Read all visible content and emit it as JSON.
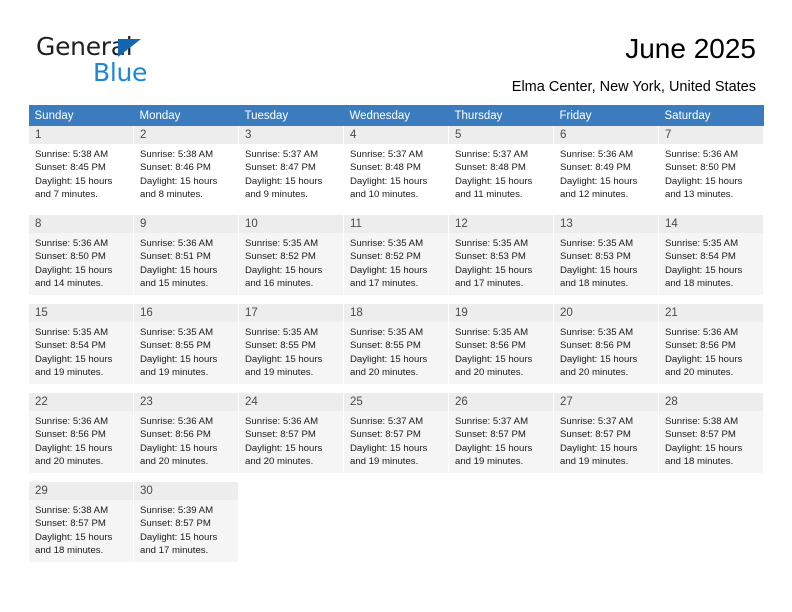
{
  "brand": {
    "name_part1": "General",
    "name_part2": "Blue",
    "accent_color": "#1d86d8",
    "triangle_color": "#1566b0"
  },
  "header": {
    "title": "June 2025",
    "subtitle": "Elma Center, New York, United States"
  },
  "calendar": {
    "header_bg": "#3b7cbf",
    "weekday_headers": [
      "Sunday",
      "Monday",
      "Tuesday",
      "Wednesday",
      "Thursday",
      "Friday",
      "Saturday"
    ],
    "weeks": [
      {
        "shaded": false,
        "days": [
          {
            "day": "1",
            "sunrise": "Sunrise: 5:38 AM",
            "sunset": "Sunset: 8:45 PM",
            "daylight_line1": "Daylight: 15 hours",
            "daylight_line2": "and 7 minutes."
          },
          {
            "day": "2",
            "sunrise": "Sunrise: 5:38 AM",
            "sunset": "Sunset: 8:46 PM",
            "daylight_line1": "Daylight: 15 hours",
            "daylight_line2": "and 8 minutes."
          },
          {
            "day": "3",
            "sunrise": "Sunrise: 5:37 AM",
            "sunset": "Sunset: 8:47 PM",
            "daylight_line1": "Daylight: 15 hours",
            "daylight_line2": "and 9 minutes."
          },
          {
            "day": "4",
            "sunrise": "Sunrise: 5:37 AM",
            "sunset": "Sunset: 8:48 PM",
            "daylight_line1": "Daylight: 15 hours",
            "daylight_line2": "and 10 minutes."
          },
          {
            "day": "5",
            "sunrise": "Sunrise: 5:37 AM",
            "sunset": "Sunset: 8:48 PM",
            "daylight_line1": "Daylight: 15 hours",
            "daylight_line2": "and 11 minutes."
          },
          {
            "day": "6",
            "sunrise": "Sunrise: 5:36 AM",
            "sunset": "Sunset: 8:49 PM",
            "daylight_line1": "Daylight: 15 hours",
            "daylight_line2": "and 12 minutes."
          },
          {
            "day": "7",
            "sunrise": "Sunrise: 5:36 AM",
            "sunset": "Sunset: 8:50 PM",
            "daylight_line1": "Daylight: 15 hours",
            "daylight_line2": "and 13 minutes."
          }
        ]
      },
      {
        "shaded": true,
        "days": [
          {
            "day": "8",
            "sunrise": "Sunrise: 5:36 AM",
            "sunset": "Sunset: 8:50 PM",
            "daylight_line1": "Daylight: 15 hours",
            "daylight_line2": "and 14 minutes."
          },
          {
            "day": "9",
            "sunrise": "Sunrise: 5:36 AM",
            "sunset": "Sunset: 8:51 PM",
            "daylight_line1": "Daylight: 15 hours",
            "daylight_line2": "and 15 minutes."
          },
          {
            "day": "10",
            "sunrise": "Sunrise: 5:35 AM",
            "sunset": "Sunset: 8:52 PM",
            "daylight_line1": "Daylight: 15 hours",
            "daylight_line2": "and 16 minutes."
          },
          {
            "day": "11",
            "sunrise": "Sunrise: 5:35 AM",
            "sunset": "Sunset: 8:52 PM",
            "daylight_line1": "Daylight: 15 hours",
            "daylight_line2": "and 17 minutes."
          },
          {
            "day": "12",
            "sunrise": "Sunrise: 5:35 AM",
            "sunset": "Sunset: 8:53 PM",
            "daylight_line1": "Daylight: 15 hours",
            "daylight_line2": "and 17 minutes."
          },
          {
            "day": "13",
            "sunrise": "Sunrise: 5:35 AM",
            "sunset": "Sunset: 8:53 PM",
            "daylight_line1": "Daylight: 15 hours",
            "daylight_line2": "and 18 minutes."
          },
          {
            "day": "14",
            "sunrise": "Sunrise: 5:35 AM",
            "sunset": "Sunset: 8:54 PM",
            "daylight_line1": "Daylight: 15 hours",
            "daylight_line2": "and 18 minutes."
          }
        ]
      },
      {
        "shaded": true,
        "days": [
          {
            "day": "15",
            "sunrise": "Sunrise: 5:35 AM",
            "sunset": "Sunset: 8:54 PM",
            "daylight_line1": "Daylight: 15 hours",
            "daylight_line2": "and 19 minutes."
          },
          {
            "day": "16",
            "sunrise": "Sunrise: 5:35 AM",
            "sunset": "Sunset: 8:55 PM",
            "daylight_line1": "Daylight: 15 hours",
            "daylight_line2": "and 19 minutes."
          },
          {
            "day": "17",
            "sunrise": "Sunrise: 5:35 AM",
            "sunset": "Sunset: 8:55 PM",
            "daylight_line1": "Daylight: 15 hours",
            "daylight_line2": "and 19 minutes."
          },
          {
            "day": "18",
            "sunrise": "Sunrise: 5:35 AM",
            "sunset": "Sunset: 8:55 PM",
            "daylight_line1": "Daylight: 15 hours",
            "daylight_line2": "and 20 minutes."
          },
          {
            "day": "19",
            "sunrise": "Sunrise: 5:35 AM",
            "sunset": "Sunset: 8:56 PM",
            "daylight_line1": "Daylight: 15 hours",
            "daylight_line2": "and 20 minutes."
          },
          {
            "day": "20",
            "sunrise": "Sunrise: 5:35 AM",
            "sunset": "Sunset: 8:56 PM",
            "daylight_line1": "Daylight: 15 hours",
            "daylight_line2": "and 20 minutes."
          },
          {
            "day": "21",
            "sunrise": "Sunrise: 5:36 AM",
            "sunset": "Sunset: 8:56 PM",
            "daylight_line1": "Daylight: 15 hours",
            "daylight_line2": "and 20 minutes."
          }
        ]
      },
      {
        "shaded": true,
        "days": [
          {
            "day": "22",
            "sunrise": "Sunrise: 5:36 AM",
            "sunset": "Sunset: 8:56 PM",
            "daylight_line1": "Daylight: 15 hours",
            "daylight_line2": "and 20 minutes."
          },
          {
            "day": "23",
            "sunrise": "Sunrise: 5:36 AM",
            "sunset": "Sunset: 8:56 PM",
            "daylight_line1": "Daylight: 15 hours",
            "daylight_line2": "and 20 minutes."
          },
          {
            "day": "24",
            "sunrise": "Sunrise: 5:36 AM",
            "sunset": "Sunset: 8:57 PM",
            "daylight_line1": "Daylight: 15 hours",
            "daylight_line2": "and 20 minutes."
          },
          {
            "day": "25",
            "sunrise": "Sunrise: 5:37 AM",
            "sunset": "Sunset: 8:57 PM",
            "daylight_line1": "Daylight: 15 hours",
            "daylight_line2": "and 19 minutes."
          },
          {
            "day": "26",
            "sunrise": "Sunrise: 5:37 AM",
            "sunset": "Sunset: 8:57 PM",
            "daylight_line1": "Daylight: 15 hours",
            "daylight_line2": "and 19 minutes."
          },
          {
            "day": "27",
            "sunrise": "Sunrise: 5:37 AM",
            "sunset": "Sunset: 8:57 PM",
            "daylight_line1": "Daylight: 15 hours",
            "daylight_line2": "and 19 minutes."
          },
          {
            "day": "28",
            "sunrise": "Sunrise: 5:38 AM",
            "sunset": "Sunset: 8:57 PM",
            "daylight_line1": "Daylight: 15 hours",
            "daylight_line2": "and 18 minutes."
          }
        ]
      },
      {
        "shaded": true,
        "days": [
          {
            "day": "29",
            "sunrise": "Sunrise: 5:38 AM",
            "sunset": "Sunset: 8:57 PM",
            "daylight_line1": "Daylight: 15 hours",
            "daylight_line2": "and 18 minutes."
          },
          {
            "day": "30",
            "sunrise": "Sunrise: 5:39 AM",
            "sunset": "Sunset: 8:57 PM",
            "daylight_line1": "Daylight: 15 hours",
            "daylight_line2": "and 17 minutes."
          },
          null,
          null,
          null,
          null,
          null
        ]
      }
    ]
  }
}
